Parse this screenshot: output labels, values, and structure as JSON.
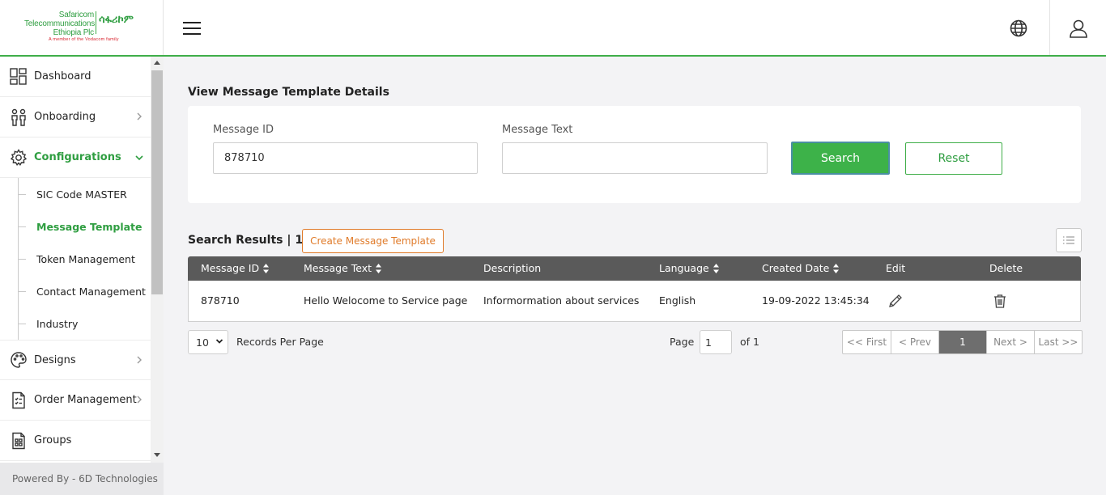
{
  "brand": {
    "line1": "Safaricom",
    "line2": "Telecommunications",
    "line3": "Ethiopia Plc",
    "amharic": "ሳፋሪኮም",
    "tagline": "A member of the Vodacom family"
  },
  "colors": {
    "accent": "#3fae49",
    "create": "#e07b2a",
    "table_header": "#5a5a5a"
  },
  "sidebar": {
    "items": [
      {
        "label": "Dashboard",
        "icon": "dashboard-icon"
      },
      {
        "label": "Onboarding",
        "icon": "onboarding-icon"
      },
      {
        "label": "Configurations",
        "icon": "gear-icon"
      }
    ],
    "sub_items": [
      {
        "label": "SIC Code MASTER"
      },
      {
        "label": "Message Template"
      },
      {
        "label": "Token Management"
      },
      {
        "label": "Contact Management"
      },
      {
        "label": "Industry"
      }
    ],
    "items_after": [
      {
        "label": "Designs",
        "icon": "palette-icon"
      },
      {
        "label": "Order Management",
        "icon": "order-icon"
      },
      {
        "label": "Groups",
        "icon": "groups-icon"
      }
    ],
    "footer": "Powered By - 6D Technologies"
  },
  "main": {
    "title": "View Message Template Details",
    "filters": {
      "message_id_label": "Message ID",
      "message_id_value": "878710",
      "message_text_label": "Message Text",
      "message_text_value": "",
      "search_label": "Search",
      "reset_label": "Reset"
    },
    "results": {
      "title": "Search Results | 1",
      "create_label": "Create Message Template"
    },
    "table": {
      "headers": [
        "Message ID",
        "Message Text",
        "Description",
        "Language",
        "Created Date",
        "Edit",
        "Delete"
      ],
      "rows": [
        [
          "878710",
          "Hello Welocome to Service page",
          "Informormation about services",
          "English",
          "19-09-2022 13:45:34"
        ]
      ]
    },
    "pagination": {
      "per_page_value": "10",
      "per_page_label": "Records Per Page",
      "page_label": "Page",
      "page_value": "1",
      "of_label": "of 1",
      "first": "<< First",
      "prev": "< Prev",
      "current": "1",
      "next": "Next >",
      "last": "Last >>"
    }
  }
}
